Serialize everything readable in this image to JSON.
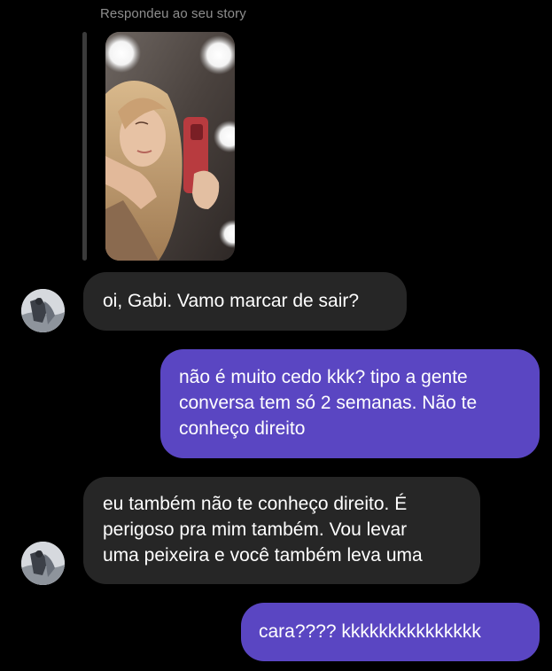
{
  "story": {
    "caption": "Respondeu ao seu story"
  },
  "messages": [
    {
      "direction": "received",
      "text": "oi, Gabi. Vamo marcar de sair?"
    },
    {
      "direction": "sent",
      "text": "não é muito cedo kkk? tipo a gente\nconversa tem só 2 semanas. Não te\nconheço direito"
    },
    {
      "direction": "received",
      "text": "eu também não te conheço direito. É\nperigoso pra mim também. Vou levar\numa peixeira e você também leva uma"
    },
    {
      "direction": "sent",
      "text": "cara???? kkkkkkkkkkkkkkk"
    }
  ],
  "colors": {
    "background": "#000000",
    "received_bubble": "#262626",
    "sent_bubble": "#5a46c2",
    "caption_text": "#8e8e8e"
  }
}
